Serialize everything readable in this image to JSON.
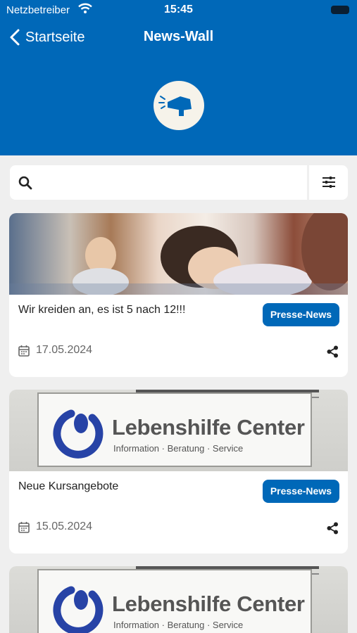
{
  "status_bar": {
    "carrier": "Netzbetreiber",
    "time": "15:45"
  },
  "nav": {
    "back_label": "Startseite",
    "title": "News-Wall"
  },
  "search": {
    "value": "",
    "placeholder": ""
  },
  "cards": [
    {
      "title": "Wir kreiden an, es ist 5 nach 12!!!",
      "badge": "Presse-News",
      "date": "17.05.2024"
    },
    {
      "title": "Neue Kursangebote",
      "badge": "Presse-News",
      "date": "15.05.2024",
      "sign_title": "Lebenshilfe Center",
      "sign_subtitle": "Information · Beratung · Service"
    },
    {
      "sign_title": "Lebenshilfe Center",
      "sign_subtitle": "Information · Beratung · Service"
    }
  ],
  "colors": {
    "brand": "#0068b8",
    "background": "#efefef"
  }
}
